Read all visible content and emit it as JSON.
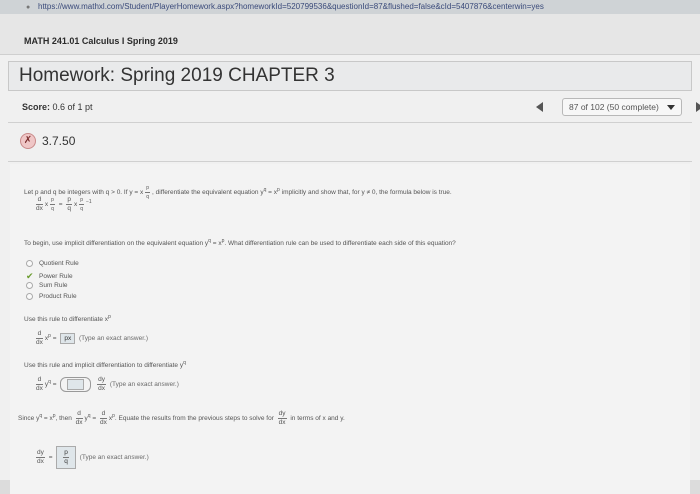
{
  "browser": {
    "url": "https://www.mathxl.com/Student/PlayerHomework.aspx?homeworkId=520799536&questionId=87&flushed=false&cId=5407876&centerwin=yes"
  },
  "course": {
    "title": "MATH 241.01 Calculus I Spring 2019"
  },
  "homework": {
    "title": "Homework: Spring 2019 CHAPTER 3"
  },
  "score": {
    "label": "Score:",
    "value": "0.6 of 1 pt"
  },
  "question_nav": {
    "status": "87 of 102 (50 complete)"
  },
  "question": {
    "number": "3.7.50",
    "status_icon": "partial-credit-icon"
  },
  "content": {
    "intro": "Let p and q be integers with q > 0. If y = x",
    "intro_mid": ", differentiate the equivalent equation y",
    "intro_end": " = x",
    "intro_tail": " implicitly and show that, for y ≠ 0, the formula below is true.",
    "formula_lhs": "d",
    "formula_den": "dx",
    "formula_var": "x",
    "formula_eq": "=",
    "formula_p": "p",
    "formula_q": "q",
    "formula_mid": "x",
    "formula_exp_minus": "−1",
    "begin_text": "To begin, use implicit differentiation on the equivalent equation y",
    "begin_text_mid": " = x",
    "begin_text_end": ". What differentiation rule can be used to differentiate each side of this equation?",
    "options": [
      {
        "label": "Quotient Rule",
        "selected": false
      },
      {
        "label": "Power Rule",
        "selected": true
      },
      {
        "label": "Sum Rule",
        "selected": false
      },
      {
        "label": "Product Rule",
        "selected": false
      }
    ],
    "use_rule_text": "Use this rule to differentiate x",
    "answer1_value": "px",
    "answer1_hint": "(Type an exact answer.)",
    "use_rule_implicit": "Use this rule and implicit differentiation to differentiate y",
    "answer2_hint": "(Type an exact answer.)",
    "since_text": "Since y",
    "since_mid": " = x",
    "since_then": ", then",
    "since_eq": "=",
    "equate_text": "Equate the results from the previous steps to solve for",
    "equate_end": "in terms of x and y.",
    "answer3_hint": "(Type an exact answer.)",
    "dy": "dy",
    "dx": "dx",
    "exp_p": "p",
    "exp_q": "q",
    "var_y": "y",
    "var_x": "x"
  }
}
